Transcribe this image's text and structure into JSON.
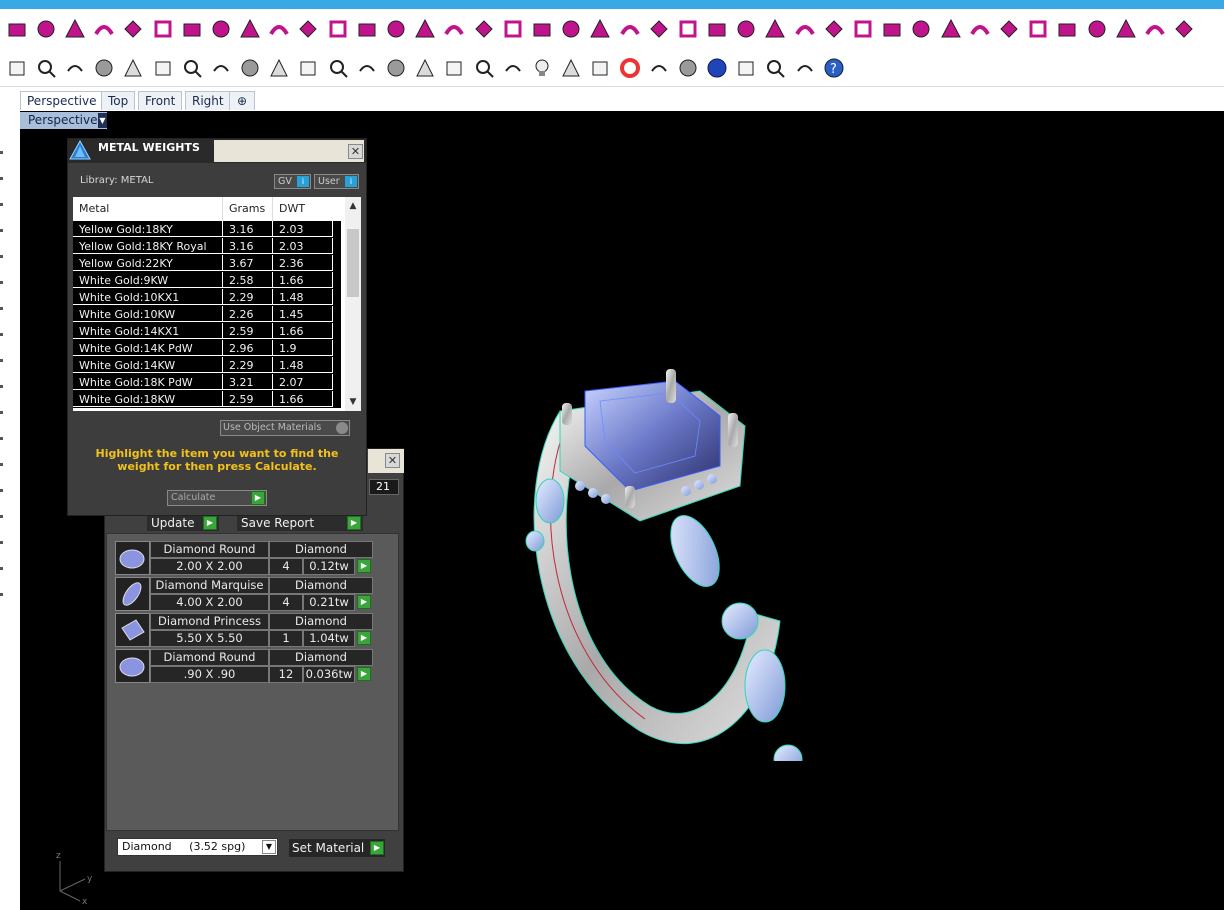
{
  "toolbar_row1": [
    "point-icon",
    "vertex-edit-icon",
    "box-icon",
    "arrow-icon",
    "curve-icon",
    "split-icon",
    "ribbon-icon",
    "arch-icon",
    "bend-icon",
    "flag-icon",
    "gem-seat-icon",
    "chain-icon",
    "gem-icon",
    "cut-icon",
    "network-icon",
    "checkbox-icon",
    "grid-icon",
    "twist-icon",
    "lattice-icon",
    "pipe-icon",
    "frame-icon",
    "signpost-icon",
    "hands-icon",
    "arc-icon",
    "ring-band-icon",
    "dots-grid-icon",
    "corner-icon",
    "hand-icon",
    "snap-icon",
    "branch-icon",
    "diamond-shape-icon",
    "target-icon",
    "transform-icon",
    "pentagon-icon",
    "prong-icon",
    "layer-icon",
    "slab-icon",
    "lattice2-icon",
    "cross-icon",
    "cube-icon",
    "gear-icon"
  ],
  "toolbar_row2": [
    "print-icon",
    "new-document-icon",
    "cut-scissors-icon",
    "copy-icon",
    "clipboard-icon",
    "undo-icon",
    "pan-hand-icon",
    "move-arrows-icon",
    "zoom-icon",
    "zoom-window-icon",
    "zoom-extents-icon",
    "zoom-selected-icon",
    "rotate-view-icon",
    "four-viewports-icon",
    "car-icon",
    "eraser-icon",
    "circle-dot-icon",
    "bounding-icon",
    "lightbulb-icon",
    "lock-icon",
    "material-icon",
    "color-wheel-icon",
    "sphere-grey-icon",
    "sphere-wire-icon",
    "sphere-blue-icon",
    "pencil-icon",
    "gears-icon",
    "dimension-icon",
    "help-icon"
  ],
  "tabs": [
    {
      "label": "Perspective",
      "active": true
    },
    {
      "label": "Top",
      "active": false
    },
    {
      "label": "Front",
      "active": false
    },
    {
      "label": "Right",
      "active": false
    }
  ],
  "viewport_label": "Perspective",
  "axis_labels": {
    "z": "z",
    "y": "y",
    "x": "x"
  },
  "metal_panel": {
    "title": "METAL WEIGHTS",
    "library": "Library: METAL",
    "gv_label": "GV",
    "user_label": "User",
    "headers": [
      "Metal",
      "Grams",
      "DWT"
    ],
    "rows": [
      {
        "metal": "Yellow Gold:18KY",
        "grams": "3.16",
        "dwt": "2.03"
      },
      {
        "metal": "Yellow Gold:18KY Royal",
        "grams": "3.16",
        "dwt": "2.03"
      },
      {
        "metal": "Yellow Gold:22KY",
        "grams": "3.67",
        "dwt": "2.36"
      },
      {
        "metal": "White Gold:9KW",
        "grams": "2.58",
        "dwt": "1.66"
      },
      {
        "metal": "White Gold:10KX1",
        "grams": "2.29",
        "dwt": "1.48"
      },
      {
        "metal": "White Gold:10KW",
        "grams": "2.26",
        "dwt": "1.45"
      },
      {
        "metal": "White Gold:14KX1",
        "grams": "2.59",
        "dwt": "1.66"
      },
      {
        "metal": "White Gold:14K PdW",
        "grams": "2.96",
        "dwt": "1.9"
      },
      {
        "metal": "White Gold:14KW",
        "grams": "2.29",
        "dwt": "1.48"
      },
      {
        "metal": "White Gold:18K PdW",
        "grams": "3.21",
        "dwt": "2.07"
      },
      {
        "metal": "White Gold:18KW",
        "grams": "2.59",
        "dwt": "1.66"
      }
    ],
    "use_object_materials": "Use Object Materials",
    "hint": "Highlight the item you want to find the weight for then press Calculate.",
    "calculate_label": "Calculate"
  },
  "report_panel": {
    "number": "21",
    "update_label": "Update",
    "save_label": "Save Report",
    "stones": [
      {
        "name": "Diamond Round",
        "size": "2.00 X 2.00",
        "material": "Diamond",
        "qty": "4",
        "tw": "0.12tw"
      },
      {
        "name": "Diamond Marquise",
        "size": "4.00 X 2.00",
        "material": "Diamond",
        "qty": "4",
        "tw": "0.21tw"
      },
      {
        "name": "Diamond Princess",
        "size": "5.50 X 5.50",
        "material": "Diamond",
        "qty": "1",
        "tw": "1.04tw"
      },
      {
        "name": "Diamond Round",
        "size": ".90 X .90",
        "material": "Diamond",
        "qty": "12",
        "tw": "0.036tw"
      }
    ],
    "material_select": "Diamond     (3.52 spg)",
    "set_material_label": "Set Material"
  },
  "colors": {
    "accent_blue": "#38a9e6",
    "toolbar_icon_magenta": "#c0148c",
    "hint_yellow": "#f2c21b",
    "go_green": "#3aa53a"
  }
}
